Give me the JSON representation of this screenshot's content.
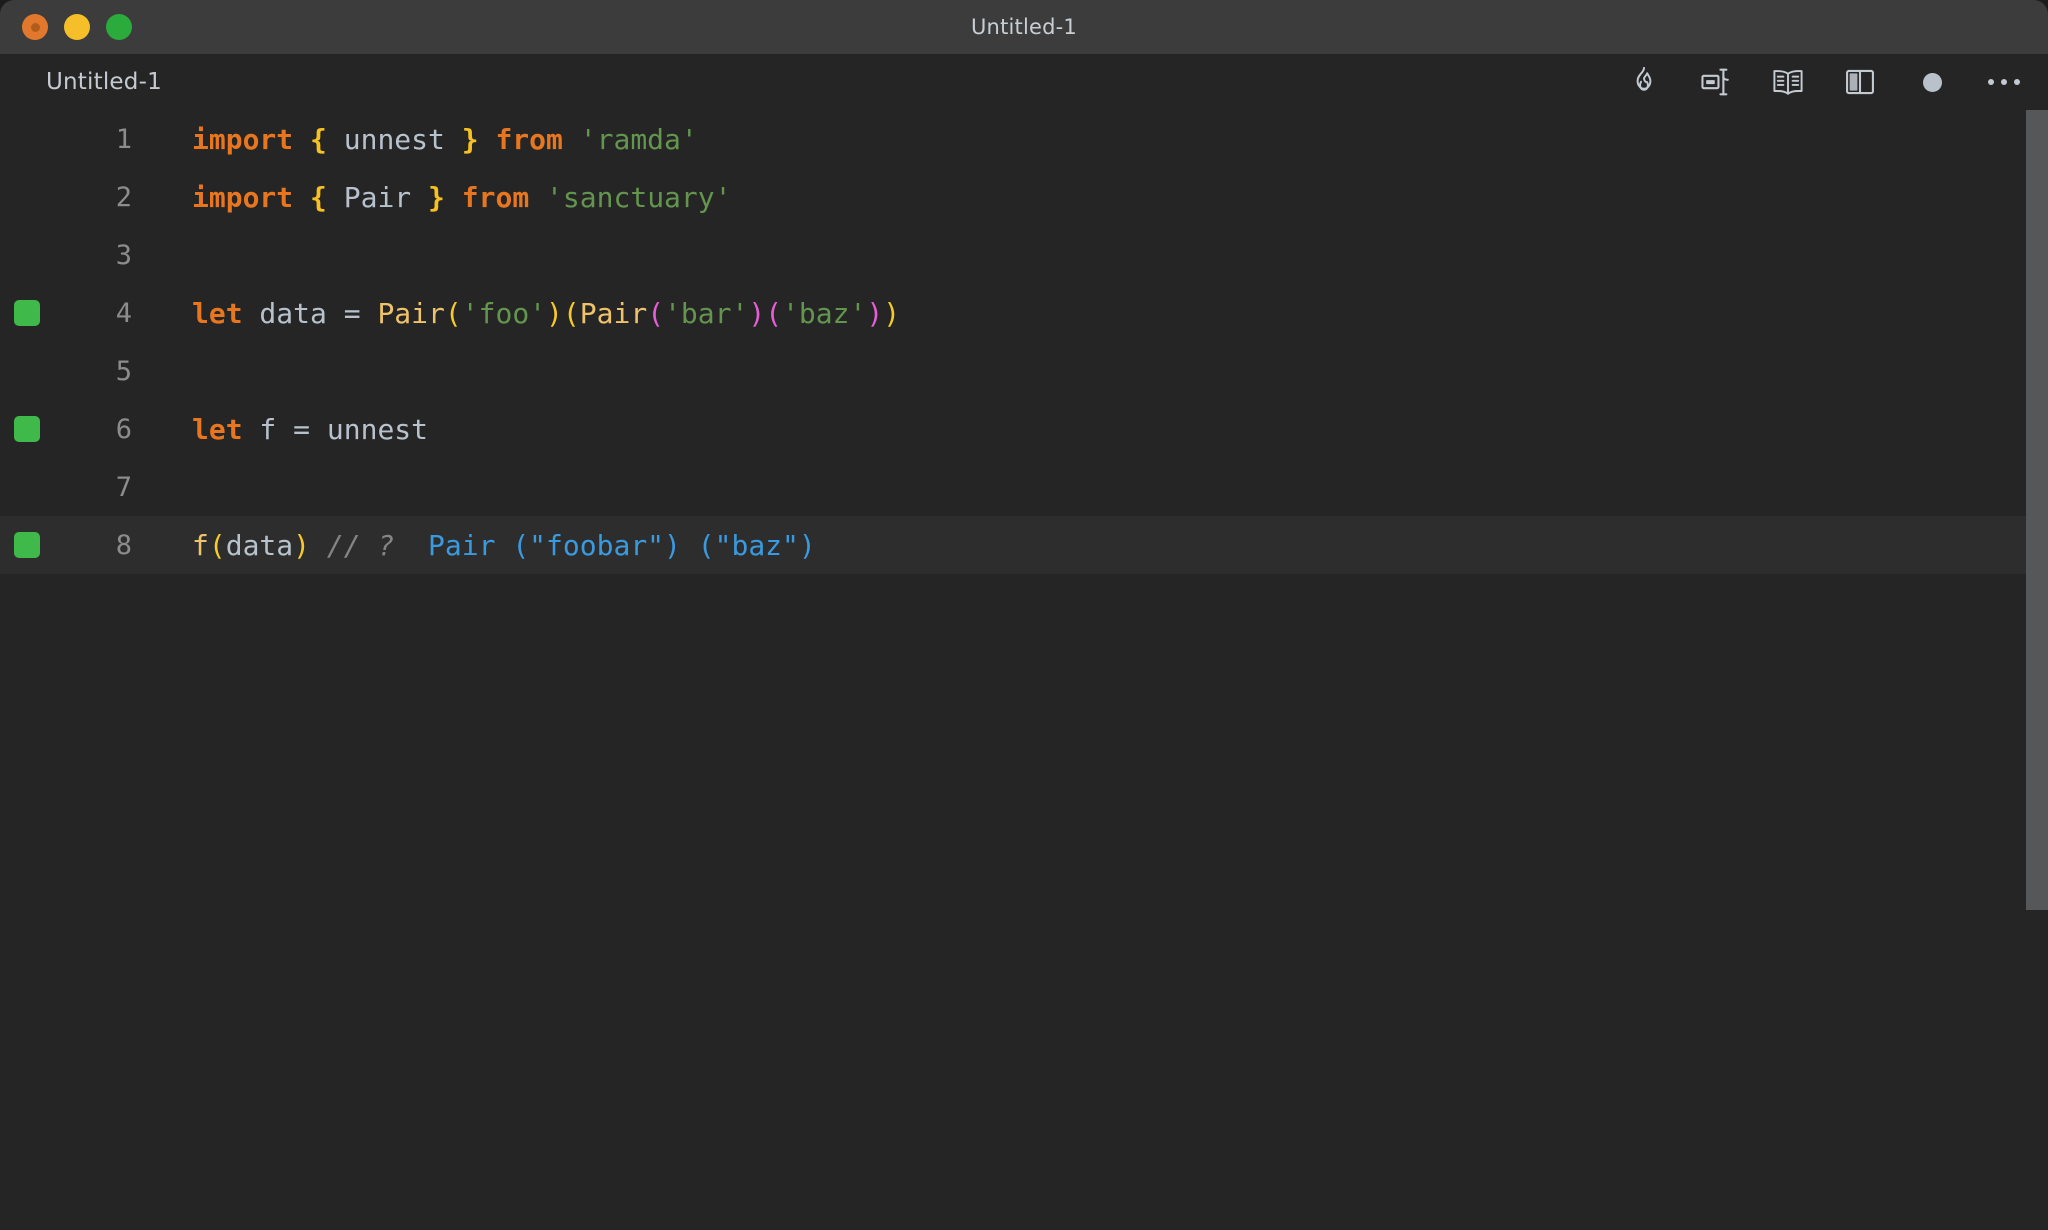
{
  "window": {
    "title": "Untitled-1",
    "traffic_lights": [
      {
        "name": "close",
        "color": "#e2782b"
      },
      {
        "name": "minimize",
        "color": "#f6bf2a"
      },
      {
        "name": "maximize",
        "color": "#2bab3c"
      }
    ]
  },
  "tabstrip": {
    "tab_label": "Untitled-1",
    "toolbar": [
      {
        "icon": "flame-icon",
        "label": "Run / Quokka"
      },
      {
        "icon": "format-code-icon",
        "label": "Format Document"
      },
      {
        "icon": "book-icon",
        "label": "Open Preview"
      },
      {
        "icon": "split-editor-icon",
        "label": "Split Editor"
      },
      {
        "icon": "record-dot-icon",
        "label": "Record"
      },
      {
        "icon": "more-actions-icon",
        "label": "More Actions..."
      }
    ]
  },
  "editor": {
    "language": "javascript",
    "active_line": 8,
    "gutter_marker_color": "#3fba4a",
    "lines": [
      {
        "number": "1",
        "marker": false,
        "active": false,
        "tokens": [
          {
            "text": "import",
            "cls": "t-kw"
          },
          {
            "text": " ",
            "cls": "t-op"
          },
          {
            "text": "{",
            "cls": "t-brace"
          },
          {
            "text": " unnest ",
            "cls": "t-ident"
          },
          {
            "text": "}",
            "cls": "t-brace"
          },
          {
            "text": " ",
            "cls": "t-op"
          },
          {
            "text": "from",
            "cls": "t-kw"
          },
          {
            "text": " ",
            "cls": "t-op"
          },
          {
            "text": "'ramda'",
            "cls": "t-str"
          }
        ]
      },
      {
        "number": "2",
        "marker": false,
        "active": false,
        "tokens": [
          {
            "text": "import",
            "cls": "t-kw"
          },
          {
            "text": " ",
            "cls": "t-op"
          },
          {
            "text": "{",
            "cls": "t-brace"
          },
          {
            "text": " Pair ",
            "cls": "t-ident"
          },
          {
            "text": "}",
            "cls": "t-brace"
          },
          {
            "text": " ",
            "cls": "t-op"
          },
          {
            "text": "from",
            "cls": "t-kw"
          },
          {
            "text": " ",
            "cls": "t-op"
          },
          {
            "text": "'sanctuary'",
            "cls": "t-str"
          }
        ]
      },
      {
        "number": "3",
        "marker": false,
        "active": false,
        "tokens": []
      },
      {
        "number": "4",
        "marker": true,
        "active": false,
        "tokens": [
          {
            "text": "let",
            "cls": "t-kw"
          },
          {
            "text": " data ",
            "cls": "t-ident"
          },
          {
            "text": "=",
            "cls": "t-op"
          },
          {
            "text": " ",
            "cls": "t-op"
          },
          {
            "text": "Pair",
            "cls": "t-fn"
          },
          {
            "text": "(",
            "cls": "t-paren1"
          },
          {
            "text": "'foo'",
            "cls": "t-str"
          },
          {
            "text": ")",
            "cls": "t-paren1"
          },
          {
            "text": "(",
            "cls": "t-paren1"
          },
          {
            "text": "Pair",
            "cls": "t-fn"
          },
          {
            "text": "(",
            "cls": "t-paren2"
          },
          {
            "text": "'bar'",
            "cls": "t-str"
          },
          {
            "text": ")",
            "cls": "t-paren2"
          },
          {
            "text": "(",
            "cls": "t-paren2"
          },
          {
            "text": "'baz'",
            "cls": "t-str"
          },
          {
            "text": ")",
            "cls": "t-paren2"
          },
          {
            "text": ")",
            "cls": "t-paren1"
          }
        ]
      },
      {
        "number": "5",
        "marker": false,
        "active": false,
        "tokens": []
      },
      {
        "number": "6",
        "marker": true,
        "active": false,
        "tokens": [
          {
            "text": "let",
            "cls": "t-kw"
          },
          {
            "text": " f ",
            "cls": "t-ident"
          },
          {
            "text": "=",
            "cls": "t-op"
          },
          {
            "text": " unnest",
            "cls": "t-ident"
          }
        ]
      },
      {
        "number": "7",
        "marker": false,
        "active": false,
        "tokens": []
      },
      {
        "number": "8",
        "marker": true,
        "active": true,
        "tokens": [
          {
            "text": "f",
            "cls": "t-fn"
          },
          {
            "text": "(",
            "cls": "t-paren1"
          },
          {
            "text": "data",
            "cls": "t-ident"
          },
          {
            "text": ")",
            "cls": "t-paren1"
          },
          {
            "text": " ",
            "cls": "t-op"
          },
          {
            "text": "// ?",
            "cls": "t-comment"
          },
          {
            "text": "  ",
            "cls": "t-op"
          },
          {
            "text": "Pair (\"foobar\") (\"baz\")",
            "cls": "t-result"
          }
        ]
      }
    ]
  }
}
